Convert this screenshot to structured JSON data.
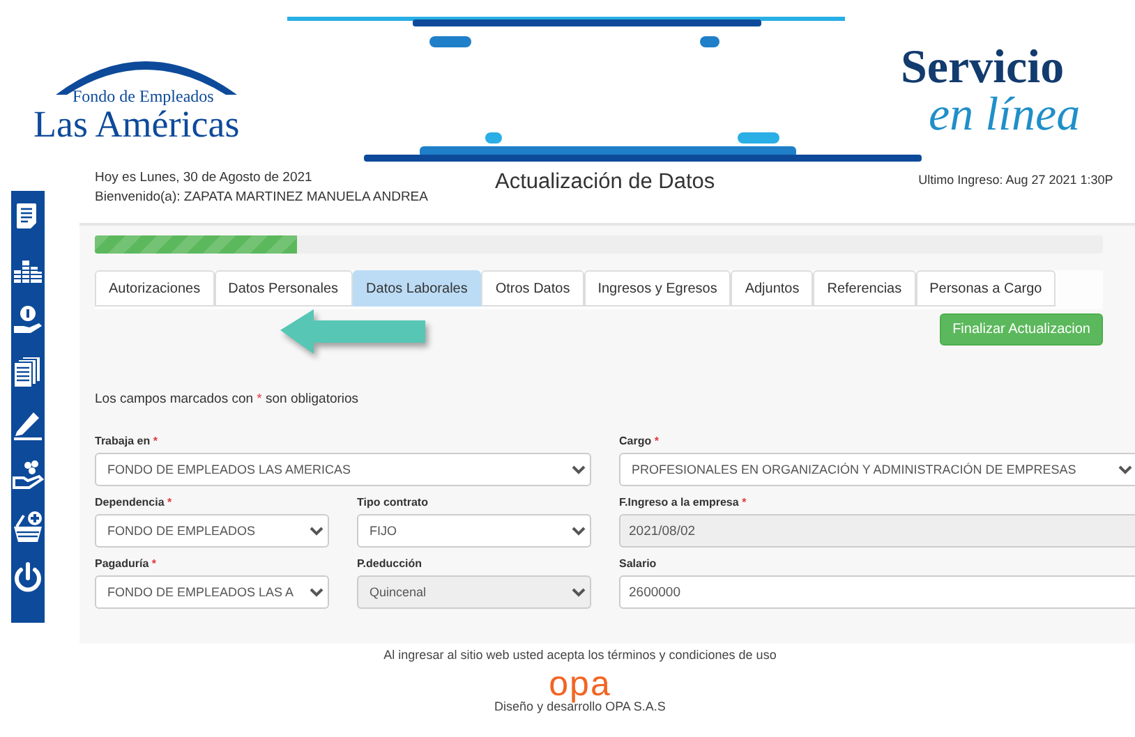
{
  "header": {
    "logo_subtitle": "Fondo de Empleados",
    "logo_title": "Las Américas",
    "service_line1": "Servicio",
    "service_line2": "en línea"
  },
  "info": {
    "date": "Hoy es Lunes, 30 de Agosto de 2021",
    "welcome": "Bienvenido(a): ZAPATA MARTINEZ MANUELA ANDREA",
    "title": "Actualización de Datos",
    "last_login": "Ultimo Ingreso: Aug 27 2021 1:30P"
  },
  "sidebar": {
    "items": [
      {
        "kind": "document"
      },
      {
        "kind": "coins"
      },
      {
        "kind": "money-hand"
      },
      {
        "kind": "documents"
      },
      {
        "kind": "pencil"
      },
      {
        "kind": "hand-dots"
      },
      {
        "kind": "basket"
      },
      {
        "kind": "power"
      }
    ]
  },
  "progress": {
    "level": 0.2
  },
  "tabs": [
    {
      "label": "Autorizaciones",
      "selected": false
    },
    {
      "label": "Datos Personales",
      "selected": false
    },
    {
      "label": "Datos Laborales",
      "selected": true
    },
    {
      "label": "Otros Datos",
      "selected": false
    },
    {
      "label": "Ingresos y Egresos",
      "selected": false
    },
    {
      "label": "Adjuntos",
      "selected": false
    },
    {
      "label": "Referencias",
      "selected": false
    },
    {
      "label": "Personas a Cargo",
      "selected": false
    }
  ],
  "finish_button": "Finalizar Actualizacion",
  "note_parts": [
    "Los campos marcados con",
    "*",
    "son obligatorios"
  ],
  "form_rows": [
    [
      {
        "label": "Trabaja en",
        "mark": "*",
        "kind": "select",
        "value": "FONDO DE EMPLEADOS LAS AMERICAS",
        "disabled": false
      },
      {
        "label": "Cargo",
        "mark": "*",
        "kind": "select",
        "value": "PROFESIONALES EN ORGANIZACIÓN Y ADMINISTRACIÓN DE EMPRESAS",
        "disabled": false
      }
    ],
    [
      {
        "label": "Dependencia",
        "mark": "*",
        "kind": "select",
        "value": "FONDO DE EMPLEADOS",
        "disabled": false
      },
      {
        "label": "Tipo contrato",
        "kind": "select",
        "value": "FIJO",
        "disabled": false
      },
      {
        "label": "F.Ingreso a la empresa",
        "mark": "*",
        "kind": "input",
        "value": "2021/08/02",
        "disabled": true
      }
    ],
    [
      {
        "label": "Pagaduría",
        "mark": "*",
        "kind": "select",
        "value": "FONDO DE EMPLEADOS LAS A",
        "disabled": false
      },
      {
        "label": "P.deducción",
        "kind": "select",
        "value": "Quincenal",
        "disabled": true
      },
      {
        "label": "Salario",
        "kind": "input",
        "value": "2600000",
        "disabled": false
      }
    ]
  ],
  "footer": {
    "terms": "Al ingresar al sitio web usted acepta los términos y condiciones de uso",
    "brand": "opa",
    "credit": "Diseño y desarrollo OPA S.A.S"
  }
}
